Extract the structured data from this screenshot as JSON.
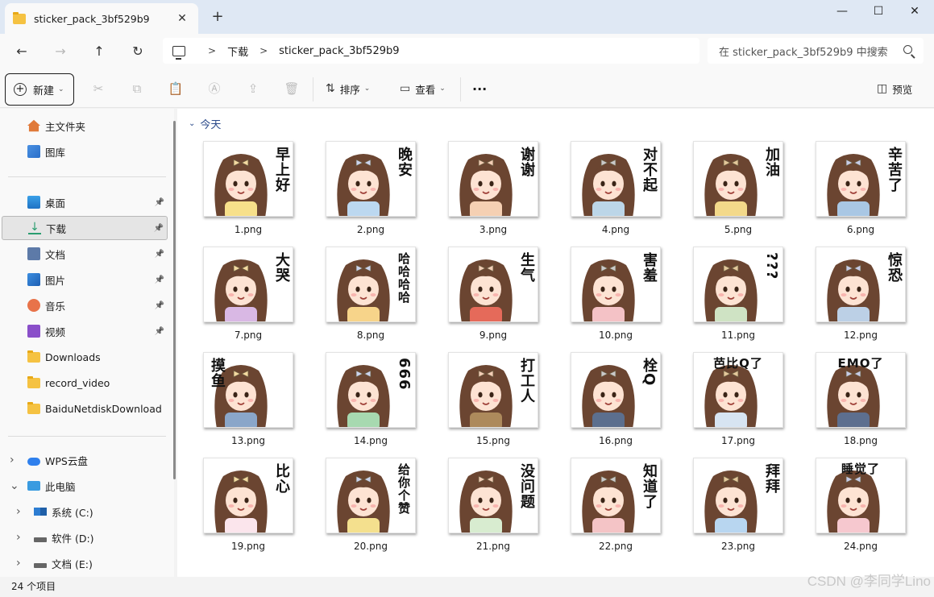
{
  "window": {
    "tab_title": "sticker_pack_3bf529b9",
    "minimize": "—",
    "maximize": "☐",
    "close": "✕"
  },
  "nav": {
    "back": "←",
    "forward": "→",
    "up": "↑",
    "refresh": "↻"
  },
  "address": {
    "crumbs": [
      "下载",
      "sticker_pack_3bf529b9"
    ],
    "separator": ">"
  },
  "search": {
    "placeholder": "在 sticker_pack_3bf529b9 中搜索"
  },
  "toolbar": {
    "new_label": "新建",
    "sort_label": "排序",
    "view_label": "查看",
    "more_label": "···",
    "preview_label": "预览"
  },
  "sidebar": {
    "quick": [
      {
        "label": "主文件夹",
        "icon": "home-icon"
      },
      {
        "label": "图库",
        "icon": "gallery-icon"
      }
    ],
    "pinned": [
      {
        "label": "桌面",
        "icon": "desktop-icon",
        "pinned": true
      },
      {
        "label": "下载",
        "icon": "download-icon",
        "pinned": true,
        "selected": true
      },
      {
        "label": "文档",
        "icon": "document-icon",
        "pinned": true
      },
      {
        "label": "图片",
        "icon": "pictures-icon",
        "pinned": true
      },
      {
        "label": "音乐",
        "icon": "music-icon",
        "pinned": true
      },
      {
        "label": "视频",
        "icon": "video-icon",
        "pinned": true
      },
      {
        "label": "Downloads",
        "icon": "folder-icon"
      },
      {
        "label": "record_video",
        "icon": "folder-icon"
      },
      {
        "label": "BaiduNetdiskDownload",
        "icon": "folder-icon"
      }
    ],
    "tree": [
      {
        "label": "WPS云盘",
        "icon": "cloud-icon",
        "expander": ">"
      },
      {
        "label": "此电脑",
        "icon": "this-pc-icon",
        "expander": "v"
      },
      {
        "label": "系统 (C:)",
        "icon": "drive-c-icon",
        "expander": ">"
      },
      {
        "label": "软件 (D:)",
        "icon": "drive-icon",
        "expander": ">"
      },
      {
        "label": "文档 (E:)",
        "icon": "drive-icon",
        "expander": ">"
      }
    ]
  },
  "content": {
    "group_title": "今天",
    "files": [
      {
        "name": "1.png",
        "caption": "早上好"
      },
      {
        "name": "2.png",
        "caption": "晚安"
      },
      {
        "name": "3.png",
        "caption": "谢谢"
      },
      {
        "name": "4.png",
        "caption": "对不起"
      },
      {
        "name": "5.png",
        "caption": "加油"
      },
      {
        "name": "6.png",
        "caption": "辛苦了"
      },
      {
        "name": "7.png",
        "caption": "大哭"
      },
      {
        "name": "8.png",
        "caption": "哈哈哈哈"
      },
      {
        "name": "9.png",
        "caption": "生气"
      },
      {
        "name": "10.png",
        "caption": "害羞"
      },
      {
        "name": "11.png",
        "caption": "???"
      },
      {
        "name": "12.png",
        "caption": "惊恐"
      },
      {
        "name": "13.png",
        "caption": "摸鱼"
      },
      {
        "name": "14.png",
        "caption": "666"
      },
      {
        "name": "15.png",
        "caption": "打工人"
      },
      {
        "name": "16.png",
        "caption": "栓Q"
      },
      {
        "name": "17.png",
        "caption": "芭比Q了"
      },
      {
        "name": "18.png",
        "caption": "EMO了"
      },
      {
        "name": "19.png",
        "caption": "比心"
      },
      {
        "name": "20.png",
        "caption": "给你个赞"
      },
      {
        "name": "21.png",
        "caption": "没问题"
      },
      {
        "name": "22.png",
        "caption": "知道了"
      },
      {
        "name": "23.png",
        "caption": "拜拜"
      },
      {
        "name": "24.png",
        "caption": "睡觉了"
      }
    ]
  },
  "status": {
    "item_count": "24 个项目"
  },
  "watermark": "CSDN @李同学Lino",
  "colors": {
    "titlebar_bg": "#dfe8f4",
    "hair": "#6b4531",
    "skin": "#fde3d3",
    "folder": "#f5c242"
  }
}
